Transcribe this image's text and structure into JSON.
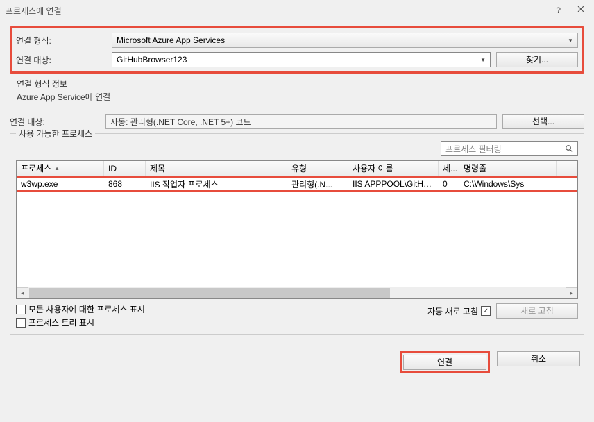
{
  "titlebar": {
    "title": "프로세스에 연결"
  },
  "form": {
    "conn_type_label": "연결 형식:",
    "conn_type_value": "Microsoft Azure App Services",
    "conn_target_label": "연결 대상:",
    "conn_target_value": "GitHubBrowser123",
    "find_button": "찾기...",
    "info_title": "연결 형식 정보",
    "info_text": "Azure App Service에 연결"
  },
  "attach": {
    "target_label": "연결 대상:",
    "target_value": "자동: 관리형(.NET Core, .NET 5+) 코드",
    "select_button": "선택..."
  },
  "processes": {
    "group_title": "사용 가능한 프로세스",
    "filter_placeholder": "프로세스 필터링",
    "columns": {
      "process": "프로세스",
      "id": "ID",
      "title": "제목",
      "type": "유형",
      "user": "사용자 이름",
      "session": "세...",
      "cmdline": "명령줄"
    },
    "rows": [
      {
        "process": "w3wp.exe",
        "id": "868",
        "title": "IIS 작업자 프로세스",
        "type": "관리형(.N...",
        "user": "IIS APPPOOL\\GitHub...",
        "session": "0",
        "cmdline": "C:\\Windows\\Sys"
      }
    ],
    "show_all_users": "모든 사용자에 대한 프로세스 표시",
    "show_process_tree": "프로세스 트리 표시",
    "auto_refresh": "자동 새로 고침",
    "auto_refresh_checked": true,
    "refresh_button": "새로 고침"
  },
  "footer": {
    "attach": "연결",
    "cancel": "취소"
  }
}
